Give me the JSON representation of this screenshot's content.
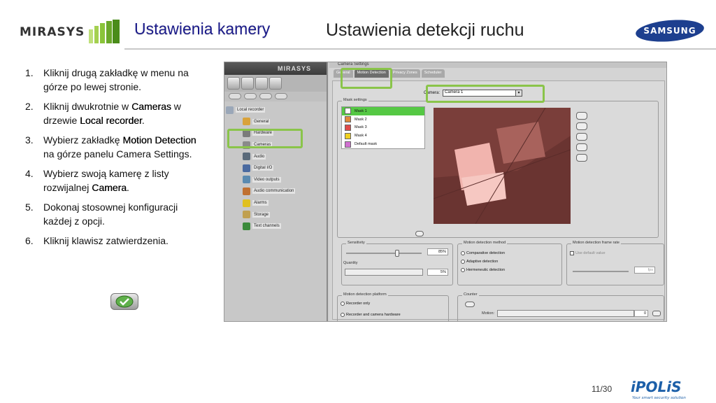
{
  "header": {
    "brand_left": "MIRASYS",
    "title_main": "Ustawienia kamery",
    "title_sub": "Ustawienia detekcji ruchu",
    "brand_right": "SAMSUNG"
  },
  "steps": [
    {
      "num": "1.",
      "parts": [
        "Kliknij drugą zakładkę w menu na górze po lewej stronie."
      ]
    },
    {
      "num": "2.",
      "a": "Kliknij dwukrotnie w ",
      "b": "Cameras",
      "c": " w drzewie ",
      "d": "Local recorder",
      "e": "."
    },
    {
      "num": "3.",
      "a": "Wybierz zakładkę ",
      "b": "Motion Detection",
      "c": " na górze panelu Camera Settings."
    },
    {
      "num": "4.",
      "a": "Wybierz swoją kamerę z listy rozwijalnej ",
      "b": "Camera",
      "c": "."
    },
    {
      "num": "5.",
      "parts": [
        "Dokonaj stosownej konfiguracji każdej z opcji."
      ]
    },
    {
      "num": "6.",
      "parts": [
        "Kliknij klawisz zatwierdzenia."
      ]
    }
  ],
  "screenshot": {
    "app_brand": "MIRASYS",
    "tree": [
      {
        "label": "Local recorder",
        "color": "#9aa7b8"
      },
      {
        "label": "General",
        "color": "#d9a23a"
      },
      {
        "label": "Hardware",
        "color": "#7b7b7b"
      },
      {
        "label": "Cameras",
        "color": "#8a8a8a"
      },
      {
        "label": "Audio",
        "color": "#5a6a7a"
      },
      {
        "label": "Digital I/O",
        "color": "#4a6aa0"
      },
      {
        "label": "Video outputs",
        "color": "#5a8ab0"
      },
      {
        "label": "Audio communication",
        "color": "#c07030"
      },
      {
        "label": "Alarms",
        "color": "#e0c020"
      },
      {
        "label": "Storage",
        "color": "#c0a050"
      },
      {
        "label": "Text channels",
        "color": "#3a8a3a"
      }
    ],
    "panel_title": "Camera Settings",
    "tabs": [
      "General",
      "Motion Detection",
      "Privacy Zones",
      "Scheduler"
    ],
    "camera_label": "Camera:",
    "camera_value": "Camera 1",
    "mask_settings_label": "Mask settings",
    "masks": [
      {
        "label": "Mask 1",
        "color": "#ffffff",
        "selected": true
      },
      {
        "label": "Mask 2",
        "color": "#e08a3a",
        "selected": false
      },
      {
        "label": "Mask 3",
        "color": "#e04a4a",
        "selected": false
      },
      {
        "label": "Mask 4",
        "color": "#f0d020",
        "selected": false
      },
      {
        "label": "Default mask",
        "color": "#d070d0",
        "selected": false
      }
    ],
    "sensitivity_label": "Sensitivity",
    "sensitivity_value": "85%",
    "quantity_label": "Quantity",
    "quantity_value": "5%",
    "method_label": "Motion detection method",
    "methods": [
      "Comparative detection",
      "Adaptive detection",
      "Hermeneutic detection"
    ],
    "frame_rate_label": "Motion detection frame rate",
    "use_default_label": "Use default value",
    "fps_value": "fps",
    "platform_label": "Motion detection platform",
    "platforms": [
      "Recorder only",
      "Recorder and camera hardware"
    ],
    "counter_label": "Counter",
    "motion_label": "Motion:",
    "motion_value": "0"
  },
  "footer": {
    "page": "11/30",
    "ipolis": "iPOLiS",
    "tagline": "Your smart security solution"
  },
  "colors": {
    "highlight": "#8ac44a",
    "title_blue": "#1a1a8a",
    "samsung_blue": "#1d3f8f"
  }
}
